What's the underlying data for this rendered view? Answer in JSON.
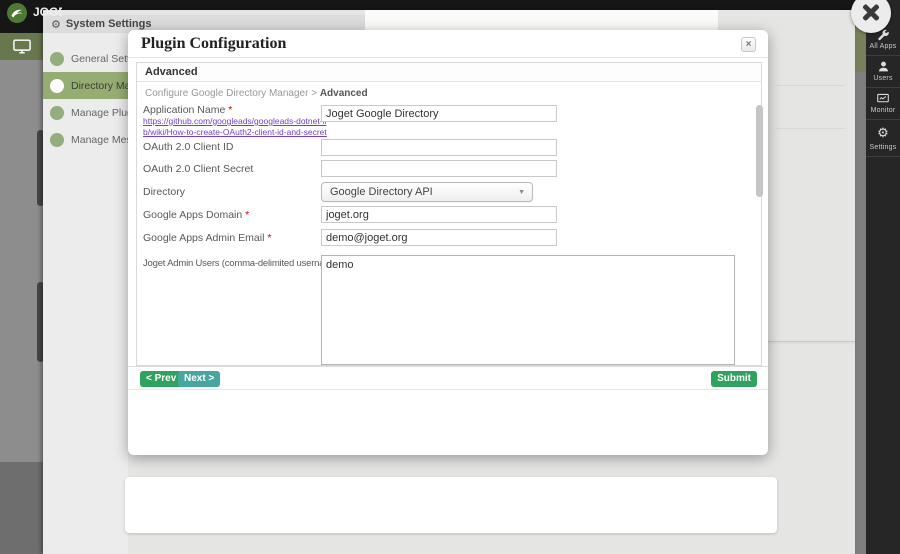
{
  "base": {
    "brand_text": "JOGET",
    "toolbar": {
      "items": [
        {
          "label": "All Apps",
          "icon": "wrench-icon"
        },
        {
          "label": "Users",
          "icon": "user-icon"
        },
        {
          "label": "Monitor",
          "icon": "monitor-chart-icon"
        },
        {
          "label": "Settings",
          "icon": "gears-icon"
        }
      ]
    }
  },
  "system_settings": {
    "title": "System Settings",
    "menu": [
      {
        "label": "General Settings",
        "selected": false
      },
      {
        "label": "Directory Manager",
        "selected": true
      },
      {
        "label": "Manage Plugins",
        "selected": false
      },
      {
        "label": "Manage Messaging",
        "selected": false
      }
    ]
  },
  "modal": {
    "title": "Plugin Configuration",
    "section_title": "Advanced",
    "breadcrumb": {
      "prefix": "Configure Google Directory Manager > ",
      "current": "Advanced"
    },
    "fields": {
      "app_name": {
        "label": "Application Name",
        "required": "*",
        "help_link": "https://github.com/googleads/googleads-dotnet-lib/wiki/How-to-create-OAuth2-client-id-and-secret",
        "value": "Joget Google Directory"
      },
      "client_id": {
        "label": "OAuth 2.0 Client ID",
        "value": ""
      },
      "client_secret": {
        "label": "OAuth 2.0 Client Secret",
        "value": ""
      },
      "directory": {
        "label": "Directory",
        "value": "Google Directory API"
      },
      "domain": {
        "label": "Google Apps Domain",
        "required": "*",
        "value": "joget.org"
      },
      "admin_email": {
        "label": "Google Apps Admin Email",
        "required": "*",
        "value": "demo@joget.org"
      },
      "admin_users": {
        "label": "Joget Admin Users (comma-delimited usernames)",
        "value": "demo"
      }
    },
    "buttons": {
      "prev": "< Prev",
      "next": "Next >",
      "submit": "Submit"
    }
  },
  "glyphs": {
    "gear": "⚙",
    "close_small": "×",
    "select_arrow": "▼"
  },
  "colors": {
    "button_green": "#2fa35e",
    "button_teal": "#48a6a0",
    "menu_selected_green": "#96ad72",
    "menu_dot_green": "#93ad7c",
    "link_purple": "#7040c8",
    "required_red": "#cc0000",
    "toolbar_dark": "#262626",
    "backdrop_gray": "#e5e5e3"
  }
}
